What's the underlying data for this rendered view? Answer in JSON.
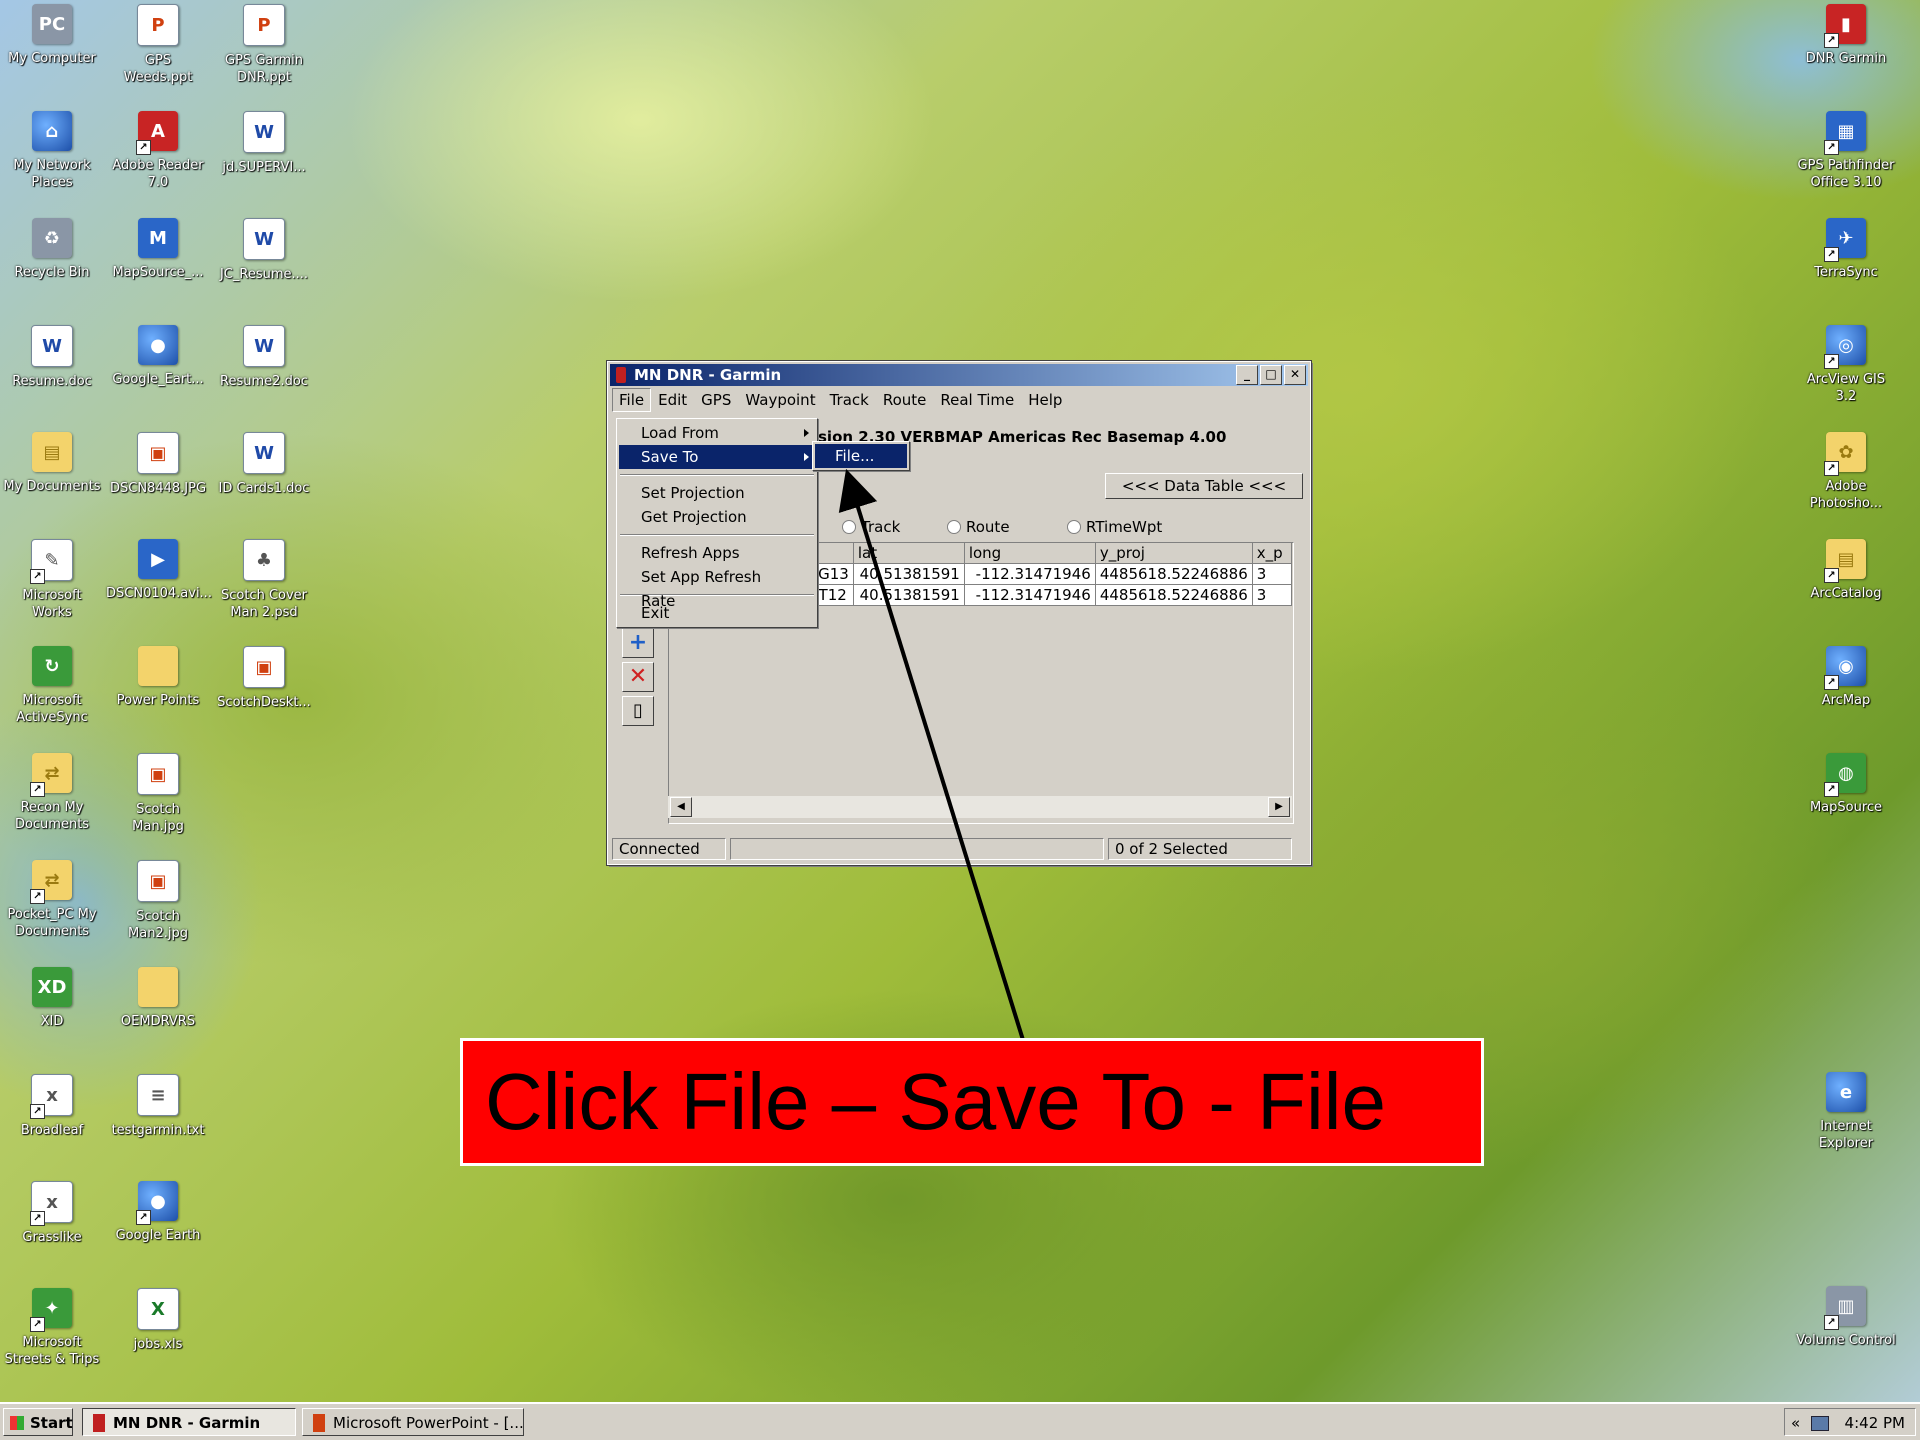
{
  "desktop": {
    "left_icons": [
      {
        "label": "My Computer",
        "glyph": "PC",
        "style": "g-gray",
        "icon": "computer-icon",
        "shortcut": false
      },
      {
        "label": "GPS\nWeeds.ppt",
        "glyph": "P",
        "style": "g-ppt",
        "icon": "powerpoint-file-icon",
        "shortcut": false
      },
      {
        "label": "GPS Garmin\nDNR.ppt",
        "glyph": "P",
        "style": "g-ppt",
        "icon": "powerpoint-file-icon",
        "shortcut": false
      },
      {
        "label": "My Network\nPlaces",
        "glyph": "⌂",
        "style": "g-globe",
        "icon": "network-places-icon",
        "shortcut": false
      },
      {
        "label": "Adobe Reader\n7.0",
        "glyph": "A",
        "style": "g-red",
        "icon": "adobe-reader-icon",
        "shortcut": true
      },
      {
        "label": "jd.SUPERVI...",
        "glyph": "W",
        "style": "g-doc",
        "icon": "word-document-icon",
        "shortcut": false
      },
      {
        "label": "Recycle Bin",
        "glyph": "♻",
        "style": "g-gray",
        "icon": "recycle-bin-icon",
        "shortcut": false
      },
      {
        "label": "MapSource_...",
        "glyph": "M",
        "style": "g-blue",
        "icon": "mapsource-installer-icon",
        "shortcut": false
      },
      {
        "label": "JC_Resume....",
        "glyph": "W",
        "style": "g-doc",
        "icon": "word-document-icon",
        "shortcut": false
      },
      {
        "label": "Resume.doc",
        "glyph": "W",
        "style": "g-doc",
        "icon": "word-document-icon",
        "shortcut": false
      },
      {
        "label": "Google_Eart...",
        "glyph": "●",
        "style": "g-globe",
        "icon": "google-earth-icon",
        "shortcut": false
      },
      {
        "label": "Resume2.doc",
        "glyph": "W",
        "style": "g-doc",
        "icon": "word-document-icon",
        "shortcut": false
      },
      {
        "label": "My Documents",
        "glyph": "▤",
        "style": "g-folder",
        "icon": "my-documents-icon",
        "shortcut": false
      },
      {
        "label": "DSCN8448.JPG",
        "glyph": "▣",
        "style": "g-ppt",
        "icon": "image-file-icon",
        "shortcut": false
      },
      {
        "label": "ID Cards1.doc",
        "glyph": "W",
        "style": "g-doc",
        "icon": "word-document-icon",
        "shortcut": false
      },
      {
        "label": "Microsoft\nWorks",
        "glyph": "✎",
        "style": "g-txt",
        "icon": "microsoft-works-icon",
        "shortcut": true
      },
      {
        "label": "DSCN0104.avi...",
        "glyph": "▶",
        "style": "g-blue",
        "icon": "video-file-icon",
        "shortcut": false
      },
      {
        "label": "Scotch Cover\nMan 2.psd",
        "glyph": "♣",
        "style": "g-txt",
        "icon": "photoshop-file-icon",
        "shortcut": false
      },
      {
        "label": "Microsoft\nActiveSync",
        "glyph": "↻",
        "style": "g-green",
        "icon": "activesync-icon",
        "shortcut": false
      },
      {
        "label": "Power Points",
        "glyph": "",
        "style": "g-folder",
        "icon": "folder-icon",
        "shortcut": false
      },
      {
        "label": "ScotchDeskt...",
        "glyph": "▣",
        "style": "g-ppt",
        "icon": "image-file-icon",
        "shortcut": false
      },
      {
        "label": "Recon My\nDocuments",
        "glyph": "⇄",
        "style": "g-folder",
        "icon": "sync-folder-icon",
        "shortcut": true
      },
      {
        "label": "Scotch\nMan.jpg",
        "glyph": "▣",
        "style": "g-ppt",
        "icon": "image-file-icon",
        "shortcut": false
      },
      {
        "label": "",
        "glyph": "",
        "style": "",
        "icon": "",
        "shortcut": false
      },
      {
        "label": "Pocket_PC My\nDocuments",
        "glyph": "⇄",
        "style": "g-folder",
        "icon": "sync-folder-icon",
        "shortcut": true
      },
      {
        "label": "Scotch\nMan2.jpg",
        "glyph": "▣",
        "style": "g-ppt",
        "icon": "image-file-icon",
        "shortcut": false
      },
      {
        "label": "",
        "glyph": "",
        "style": "",
        "icon": "",
        "shortcut": false
      },
      {
        "label": "XID",
        "glyph": "XD",
        "style": "g-green",
        "icon": "xid-icon",
        "shortcut": false
      },
      {
        "label": "OEMDRVRS",
        "glyph": "",
        "style": "g-folder",
        "icon": "folder-icon",
        "shortcut": false
      },
      {
        "label": "",
        "glyph": "",
        "style": "",
        "icon": "",
        "shortcut": false
      },
      {
        "label": "Broadleaf",
        "glyph": "x",
        "style": "g-txt",
        "icon": "broadleaf-shortcut-icon",
        "shortcut": true
      },
      {
        "label": "testgarmin.txt",
        "glyph": "≡",
        "style": "g-txt",
        "icon": "text-file-icon",
        "shortcut": false
      },
      {
        "label": "",
        "glyph": "",
        "style": "",
        "icon": "",
        "shortcut": false
      },
      {
        "label": "Grasslike",
        "glyph": "x",
        "style": "g-txt",
        "icon": "grasslike-shortcut-icon",
        "shortcut": true
      },
      {
        "label": "Google Earth",
        "glyph": "●",
        "style": "g-globe",
        "icon": "google-earth-icon",
        "shortcut": true
      },
      {
        "label": "",
        "glyph": "",
        "style": "",
        "icon": "",
        "shortcut": false
      },
      {
        "label": "Microsoft\nStreets & Trips",
        "glyph": "✦",
        "style": "g-green",
        "icon": "streets-trips-icon",
        "shortcut": true
      },
      {
        "label": "jobs.xls",
        "glyph": "X",
        "style": "g-xls",
        "icon": "excel-file-icon",
        "shortcut": false
      },
      {
        "label": "",
        "glyph": "",
        "style": "",
        "icon": "",
        "shortcut": false
      }
    ],
    "right_icons": [
      {
        "label": "DNR Garmin",
        "glyph": "▮",
        "style": "g-red",
        "icon": "dnr-garmin-icon",
        "shortcut": true
      },
      {
        "label": "GPS Pathfinder\nOffice 3.10",
        "glyph": "▦",
        "style": "g-blue",
        "icon": "gps-pathfinder-icon",
        "shortcut": true
      },
      {
        "label": "TerraSync",
        "glyph": "✈",
        "style": "g-blue",
        "icon": "terrasync-icon",
        "shortcut": true
      },
      {
        "label": "ArcView GIS\n3.2",
        "glyph": "◎",
        "style": "g-globe",
        "icon": "arcview-icon",
        "shortcut": true
      },
      {
        "label": "Adobe\nPhotosho...",
        "glyph": "✿",
        "style": "g-folder",
        "icon": "photoshop-icon",
        "shortcut": true
      },
      {
        "label": "ArcCatalog",
        "glyph": "▤",
        "style": "g-folder",
        "icon": "arccatalog-icon",
        "shortcut": true
      },
      {
        "label": "ArcMap",
        "glyph": "◉",
        "style": "g-globe",
        "icon": "arcmap-icon",
        "shortcut": true
      },
      {
        "label": "MapSource",
        "glyph": "◍",
        "style": "g-green",
        "icon": "mapsource-icon",
        "shortcut": true
      },
      {
        "label": "Internet\nExplorer",
        "glyph": "e",
        "style": "g-globe",
        "icon": "internet-explorer-icon",
        "shortcut": false
      },
      {
        "label": "Volume Control",
        "glyph": "▥",
        "style": "g-gray",
        "icon": "volume-control-icon",
        "shortcut": true
      }
    ]
  },
  "window": {
    "title": "MN DNR - Garmin",
    "menubar": [
      "File",
      "Edit",
      "GPS",
      "Waypoint",
      "Track",
      "Route",
      "Real Time",
      "Help"
    ],
    "info_line": "sion 2.30 VERBMAP Americas Rec Basemap 4.00",
    "data_table_button": "<<< Data Table <<<",
    "radios": [
      "Track",
      "Route",
      "RTimeWpt"
    ],
    "table": {
      "headers": [
        "nt",
        "lat",
        "long",
        "y_proj",
        "x_p"
      ],
      "rows": [
        [
          "01BG13",
          "40.51381591",
          "-112.31471946",
          "4485618.52246886",
          "3"
        ],
        [
          "02CT12",
          "40.51381591",
          "-112.31471946",
          "4485618.52246886",
          "3"
        ]
      ]
    },
    "status": {
      "left": "Connected",
      "middle": "",
      "right": "0 of 2 Selected"
    }
  },
  "file_menu": {
    "items": [
      "Load From",
      "Save To",
      "---",
      "Set Projection",
      "Get Projection",
      "---",
      "Refresh Apps",
      "Set App Refresh Rate",
      "---",
      "Exit"
    ],
    "selected": "Save To",
    "submenu_item": "File..."
  },
  "annotation": {
    "text": "Click File – Save To - File",
    "background": "#ff0000"
  },
  "taskbar": {
    "start_label": "Start",
    "tasks": [
      {
        "label": "MN DNR - Garmin",
        "active": true
      },
      {
        "label": "Microsoft PowerPoint - [...",
        "active": false
      }
    ],
    "tray_chevron": "«",
    "clock": "4:42 PM"
  }
}
